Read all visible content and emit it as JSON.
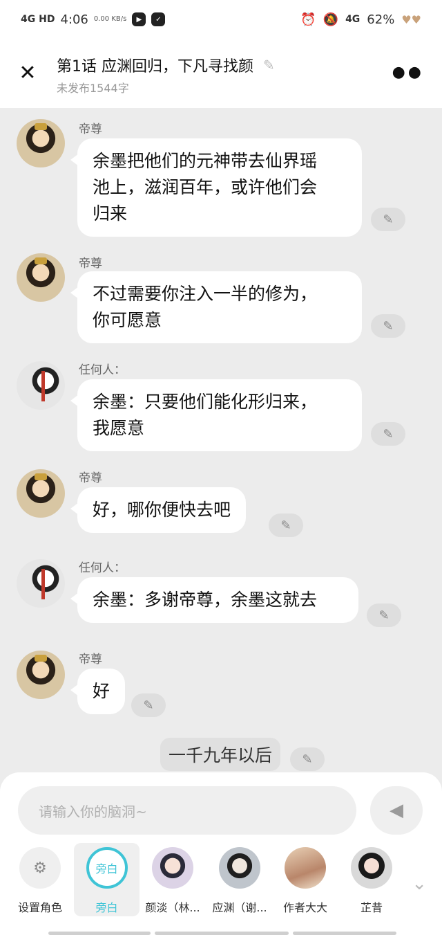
{
  "status_bar": {
    "network": "4G HD",
    "time": "4:06",
    "speed": "0.00 KB/s",
    "network_right": "4G",
    "battery": "62%"
  },
  "header": {
    "title": "第1话  应渊回归，下凡寻找颜",
    "subtitle": "未发布1544字"
  },
  "messages": [
    {
      "speaker": "帝尊",
      "text_lines": [
        "余墨把他们的元神带去仙界瑶",
        "池上，滋润百年，或许他们会",
        "归来"
      ]
    },
    {
      "speaker": "帝尊",
      "text_lines": [
        "不过需要你注入一半的修为，",
        "你可愿意"
      ]
    },
    {
      "speaker": "任何人：",
      "text_lines": [
        "余墨：只要他们能化形归来，",
        "我愿意"
      ]
    },
    {
      "speaker": "帝尊",
      "text_lines": [
        "好，哪你便快去吧"
      ]
    },
    {
      "speaker": "任何人：",
      "text_lines": [
        "余墨：多谢帝尊，余墨这就去"
      ]
    },
    {
      "speaker": "帝尊",
      "text_lines": [
        "好"
      ]
    }
  ],
  "narration": "一千九年以后",
  "compose": {
    "placeholder": "请输入你的脑洞~"
  },
  "roles": [
    {
      "label": "设置角色",
      "icon": "person-settings-icon"
    },
    {
      "label": "旁白",
      "inner": "旁白",
      "selected": true
    },
    {
      "label": "颜淡（林..."
    },
    {
      "label": "应渊（谢..."
    },
    {
      "label": "作者大大"
    },
    {
      "label": "芷昔"
    }
  ],
  "colors": {
    "accent": "#3fc4d6",
    "chat_bg": "#ececec",
    "bubble": "#ffffff"
  }
}
